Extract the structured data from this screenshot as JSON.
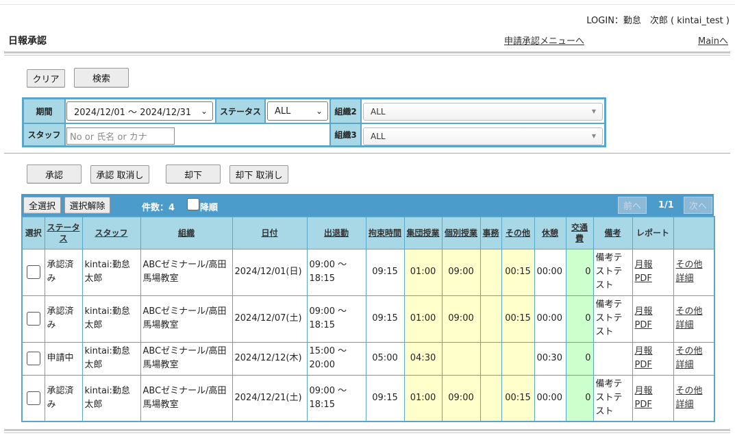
{
  "header": {
    "login": "LOGIN：勤怠　次郎 ( kintai_test )",
    "title": "日報承認",
    "link_approval_menu": "申請承認メニューへ",
    "link_main": "Mainへ"
  },
  "search": {
    "clear_label": "クリア",
    "search_label": "検索",
    "period_label": "期間",
    "period_value": "2024/12/01 ～ 2024/12/31",
    "status_label": "ステータス",
    "status_value": "ALL",
    "org2_label": "組織2",
    "org2_value": "ALL",
    "staff_label": "スタッフ",
    "staff_placeholder": "No or 氏名 or カナ",
    "org3_label": "組織3",
    "org3_value": "ALL"
  },
  "actions": {
    "approve": "承認",
    "approve_cancel": "承認 取消し",
    "reject": "却下",
    "reject_cancel": "却下 取消し"
  },
  "list": {
    "select_all": "全選択",
    "deselect": "選択解除",
    "count": "件数：4",
    "desc_label": "降順",
    "prev": "前へ",
    "page": "1/1",
    "next": "次へ",
    "columns": {
      "select": "選択",
      "status": "ステータス",
      "staff": "スタッフ",
      "org": "組織",
      "date": "日付",
      "attendance": "出退勤",
      "restraint": "拘束時間",
      "group": "集団授業",
      "individual": "個別授業",
      "office": "事務",
      "other": "その他",
      "break": "休憩",
      "transport": "交通費",
      "remarks": "備考",
      "report": "レポート"
    },
    "rows": [
      {
        "status": "承認済み",
        "staff": "kintai:勤怠太郎",
        "org": "ABCゼミナール/高田馬場教室",
        "date": "2024/12/01(日)",
        "time": "09:00 ～ 18:15",
        "restraint": "09:15",
        "group": "01:00",
        "individual": "09:00",
        "office": "",
        "other": "00:15",
        "break": "00:00",
        "transport": "0",
        "remarks": "備考テストテスト",
        "monthly": "月報",
        "pdf": "PDF",
        "other_link": "その他",
        "detail": "詳細"
      },
      {
        "status": "承認済み",
        "staff": "kintai:勤怠太郎",
        "org": "ABCゼミナール/高田馬場教室",
        "date": "2024/12/07(土)",
        "time": "09:00 ～ 18:15",
        "restraint": "09:15",
        "group": "01:00",
        "individual": "09:00",
        "office": "",
        "other": "00:15",
        "break": "00:00",
        "transport": "0",
        "remarks": "備考テストテスト",
        "monthly": "月報",
        "pdf": "PDF",
        "other_link": "その他",
        "detail": "詳細"
      },
      {
        "status": "申請中",
        "staff": "kintai:勤怠太郎",
        "org": "ABCゼミナール/高田馬場教室",
        "date": "2024/12/12(木)",
        "time": "15:00 ～ 20:00",
        "restraint": "05:00",
        "group": "04:30",
        "individual": "",
        "office": "",
        "other": "",
        "break": "00:30",
        "transport": "0",
        "remarks": "",
        "monthly": "月報",
        "pdf": "PDF",
        "other_link": "その他",
        "detail": "詳細"
      },
      {
        "status": "承認済み",
        "staff": "kintai:勤怠太郎",
        "org": "ABCゼミナール/高田馬場教室",
        "date": "2024/12/21(土)",
        "time": "09:00 ～ 18:15",
        "restraint": "09:15",
        "group": "01:00",
        "individual": "09:00",
        "office": "",
        "other": "00:15",
        "break": "00:00",
        "transport": "0",
        "remarks": "備考テストテスト",
        "monthly": "月報",
        "pdf": "PDF",
        "other_link": "その他",
        "detail": "詳細"
      }
    ]
  }
}
